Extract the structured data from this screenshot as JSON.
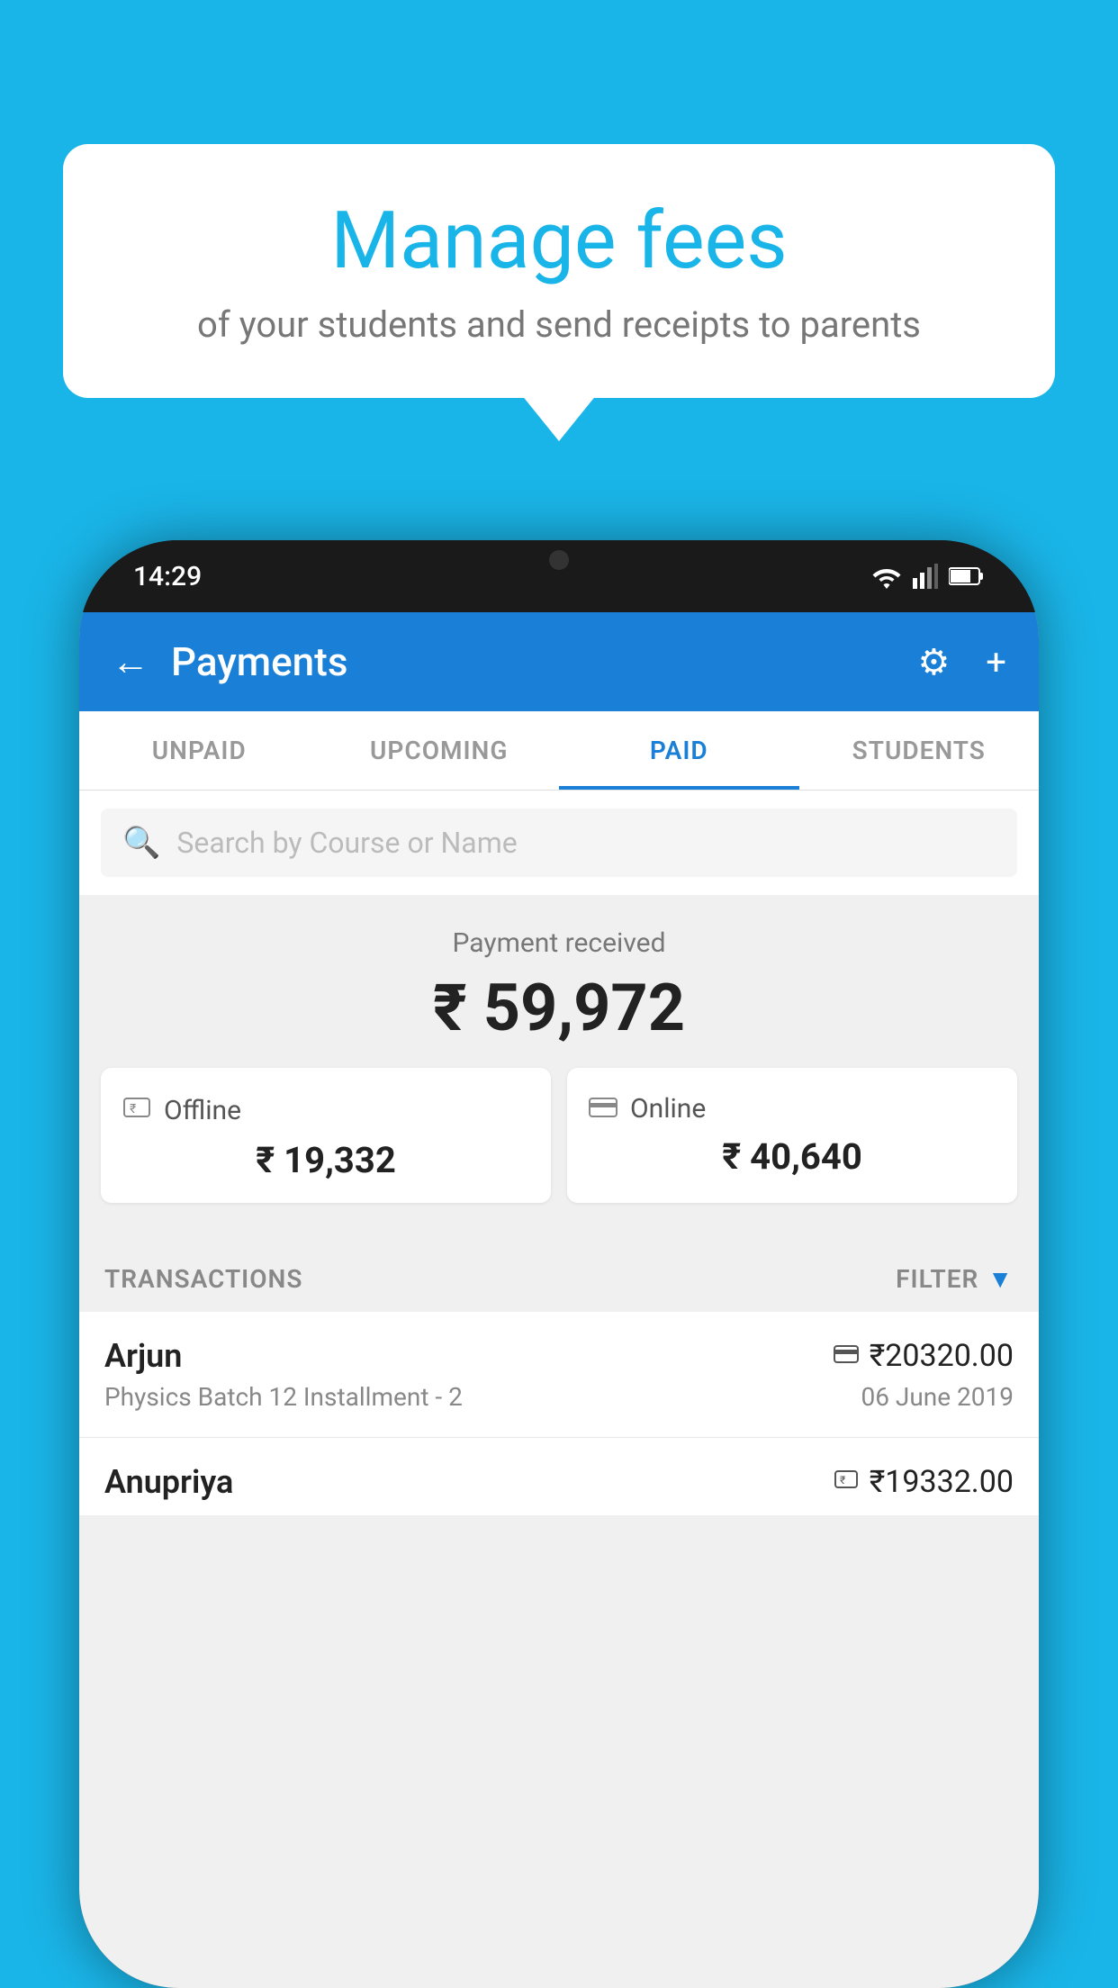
{
  "background_color": "#1ab5e8",
  "bubble": {
    "title": "Manage fees",
    "subtitle": "of your students and send receipts to parents"
  },
  "status_bar": {
    "time": "14:29"
  },
  "app_bar": {
    "title": "Payments",
    "back_icon": "←",
    "settings_icon": "⚙",
    "add_icon": "+"
  },
  "tabs": [
    {
      "label": "UNPAID",
      "active": false
    },
    {
      "label": "UPCOMING",
      "active": false
    },
    {
      "label": "PAID",
      "active": true
    },
    {
      "label": "STUDENTS",
      "active": false
    }
  ],
  "search": {
    "placeholder": "Search by Course or Name"
  },
  "payment_received": {
    "label": "Payment received",
    "amount": "₹ 59,972",
    "offline_label": "Offline",
    "offline_amount": "₹ 19,332",
    "online_label": "Online",
    "online_amount": "₹ 40,640"
  },
  "transactions": {
    "header_label": "TRANSACTIONS",
    "filter_label": "FILTER",
    "items": [
      {
        "name": "Arjun",
        "amount": "₹20320.00",
        "course": "Physics Batch 12 Installment - 2",
        "date": "06 June 2019",
        "payment_type": "card"
      },
      {
        "name": "Anupriya",
        "amount": "₹19332.00",
        "course": "",
        "date": "",
        "payment_type": "cash"
      }
    ]
  }
}
